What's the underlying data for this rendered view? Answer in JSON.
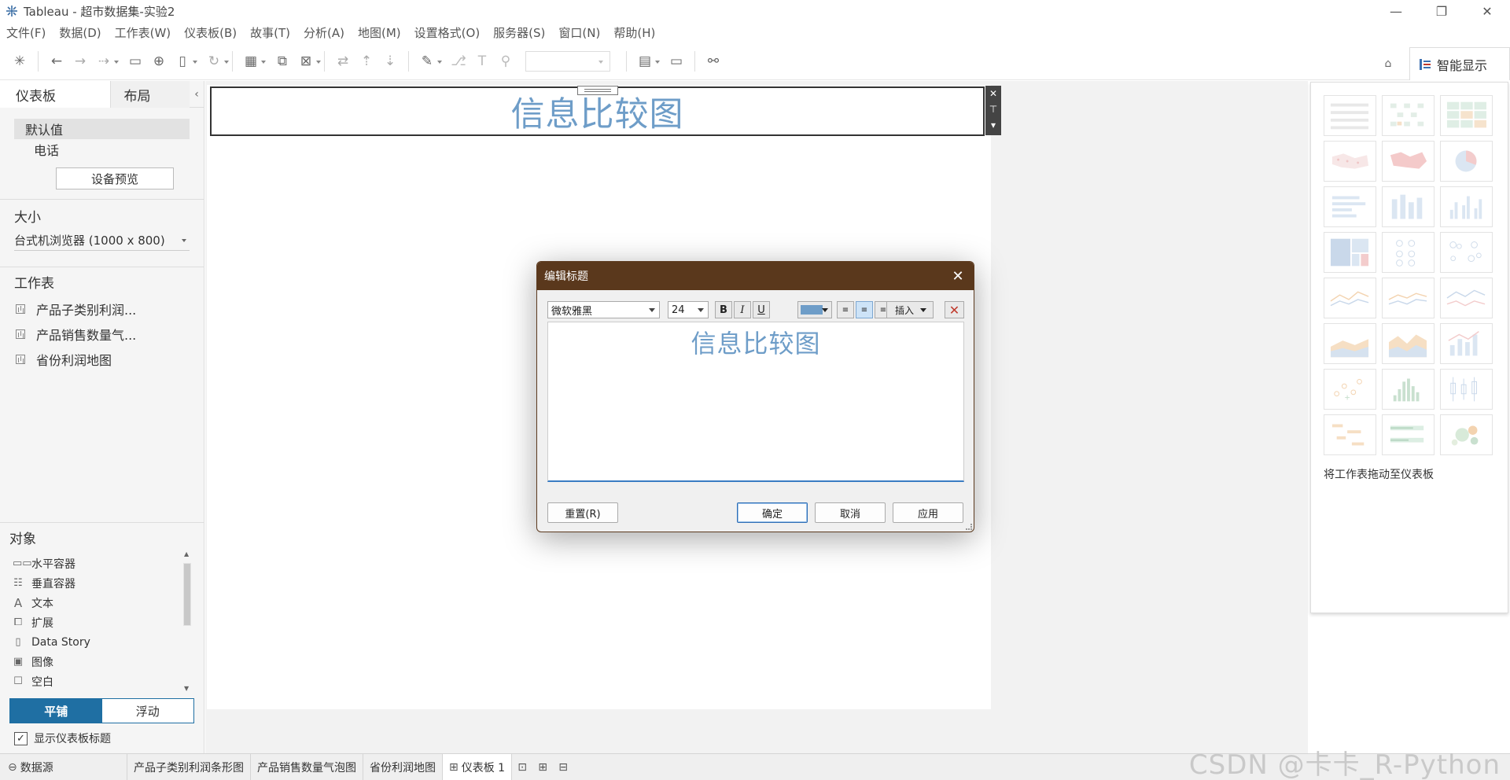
{
  "window": {
    "title": "Tableau - 超市数据集-实验2"
  },
  "menu": [
    "文件(F)",
    "数据(D)",
    "工作表(W)",
    "仪表板(B)",
    "故事(T)",
    "分析(A)",
    "地图(M)",
    "设置格式(O)",
    "服务器(S)",
    "窗口(N)",
    "帮助(H)"
  ],
  "toolbar": {
    "smart_show": "智能显示"
  },
  "left_panel": {
    "tabs": {
      "dashboard": "仪表板",
      "layout": "布局"
    },
    "devices": {
      "default": "默认值",
      "phone": "电话",
      "preview_button": "设备预览"
    },
    "size": {
      "heading": "大小",
      "value": "台式机浏览器 (1000 x 800)"
    },
    "worksheets": {
      "heading": "工作表",
      "items": [
        "产品子类别利润...",
        "产品销售数量气...",
        "省份利润地图"
      ]
    },
    "objects": {
      "heading": "对象",
      "items": [
        {
          "label": "水平容器",
          "icon": "horizontal-container-icon"
        },
        {
          "label": "垂直容器",
          "icon": "vertical-container-icon"
        },
        {
          "label": "文本",
          "icon": "text-icon"
        },
        {
          "label": "扩展",
          "icon": "extension-icon"
        },
        {
          "label": "Data Story",
          "icon": "data-story-icon"
        },
        {
          "label": "图像",
          "icon": "image-icon"
        },
        {
          "label": "空白",
          "icon": "blank-icon"
        }
      ]
    },
    "layout_mode": {
      "tiled": "平铺",
      "floating": "浮动",
      "selected": "tiled"
    },
    "show_title": {
      "label": "显示仪表板标题",
      "checked": true
    }
  },
  "dashboard": {
    "title": "信息比较图",
    "title_color": "#6e9dc8"
  },
  "right_panel": {
    "drag_hint": "将工作表拖动至仪表板"
  },
  "dialog": {
    "title": "编辑标题",
    "font": "微软雅黑",
    "size": "24",
    "bold": "B",
    "italic": "I",
    "underline": "U",
    "text_color": "#6e9dc8",
    "align_selected": "center",
    "insert": "插入",
    "content": "信息比较图",
    "buttons": {
      "reset": "重置(R)",
      "ok": "确定",
      "cancel": "取消",
      "apply": "应用"
    }
  },
  "bottom_tabs": {
    "datasource": "数据源",
    "sheets": [
      "产品子类别利润条形图",
      "产品销售数量气泡图",
      "省份利润地图"
    ],
    "active": "仪表板 1"
  },
  "watermark": "CSDN @卡卡_R-Python"
}
